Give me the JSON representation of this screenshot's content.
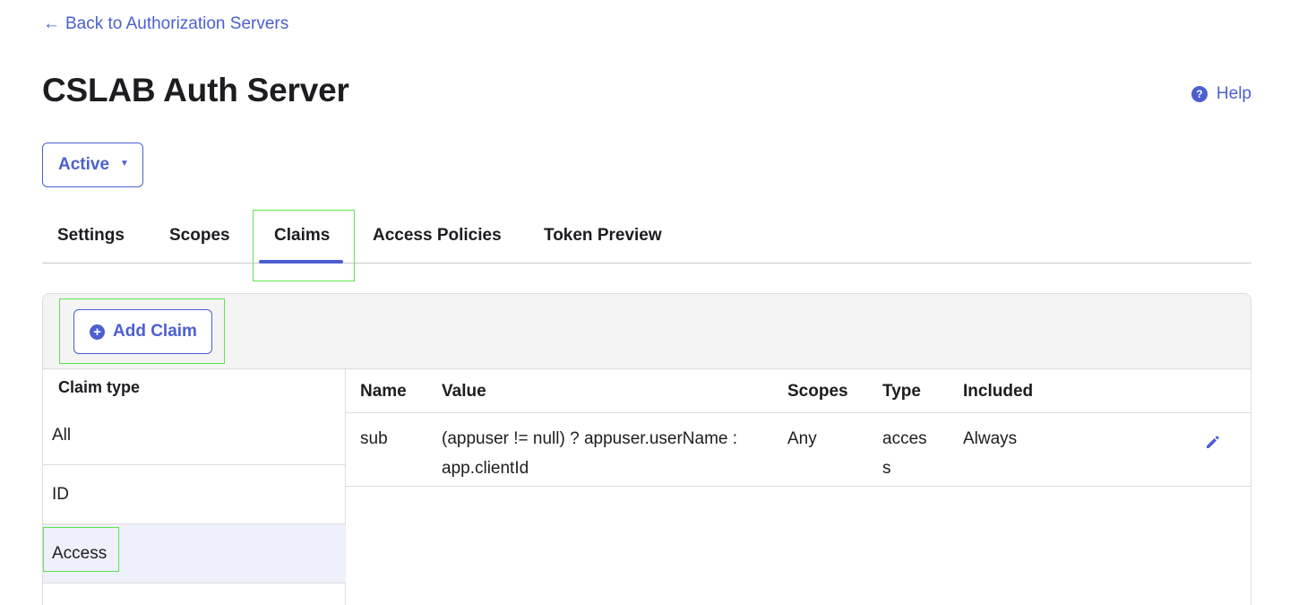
{
  "nav": {
    "back_arrow": "←",
    "back_label": "Back to Authorization Servers"
  },
  "page": {
    "title": "CSLAB Auth Server"
  },
  "help": {
    "icon_glyph": "?",
    "label": "Help"
  },
  "status": {
    "selected": "Active",
    "caret": "▼"
  },
  "tabs": [
    {
      "label": "Settings",
      "active": false
    },
    {
      "label": "Scopes",
      "active": false
    },
    {
      "label": "Claims",
      "active": true
    },
    {
      "label": "Access Policies",
      "active": false
    },
    {
      "label": "Token Preview",
      "active": false
    }
  ],
  "toolbar": {
    "add_claim_label": "Add Claim",
    "add_icon_glyph": "+"
  },
  "claim_types": {
    "header": "Claim type",
    "items": [
      {
        "label": "All",
        "selected": false
      },
      {
        "label": "ID",
        "selected": false
      },
      {
        "label": "Access",
        "selected": true
      }
    ]
  },
  "claims_table": {
    "columns": [
      "Name",
      "Value",
      "Scopes",
      "Type",
      "Included"
    ],
    "rows": [
      {
        "name": "sub",
        "value_line1": "(appuser != null) ? appuser.userName :",
        "value_line2": "app.clientId",
        "scopes": "Any",
        "type_line1": "acces",
        "type_line2": "s",
        "included": "Always",
        "action_icon": "pencil-icon"
      }
    ]
  },
  "colors": {
    "accent": "#4b5fd1",
    "highlight": "#5ee34f",
    "selected_row": "#eef0fb",
    "toolbar_bg": "#f4f4f5"
  }
}
